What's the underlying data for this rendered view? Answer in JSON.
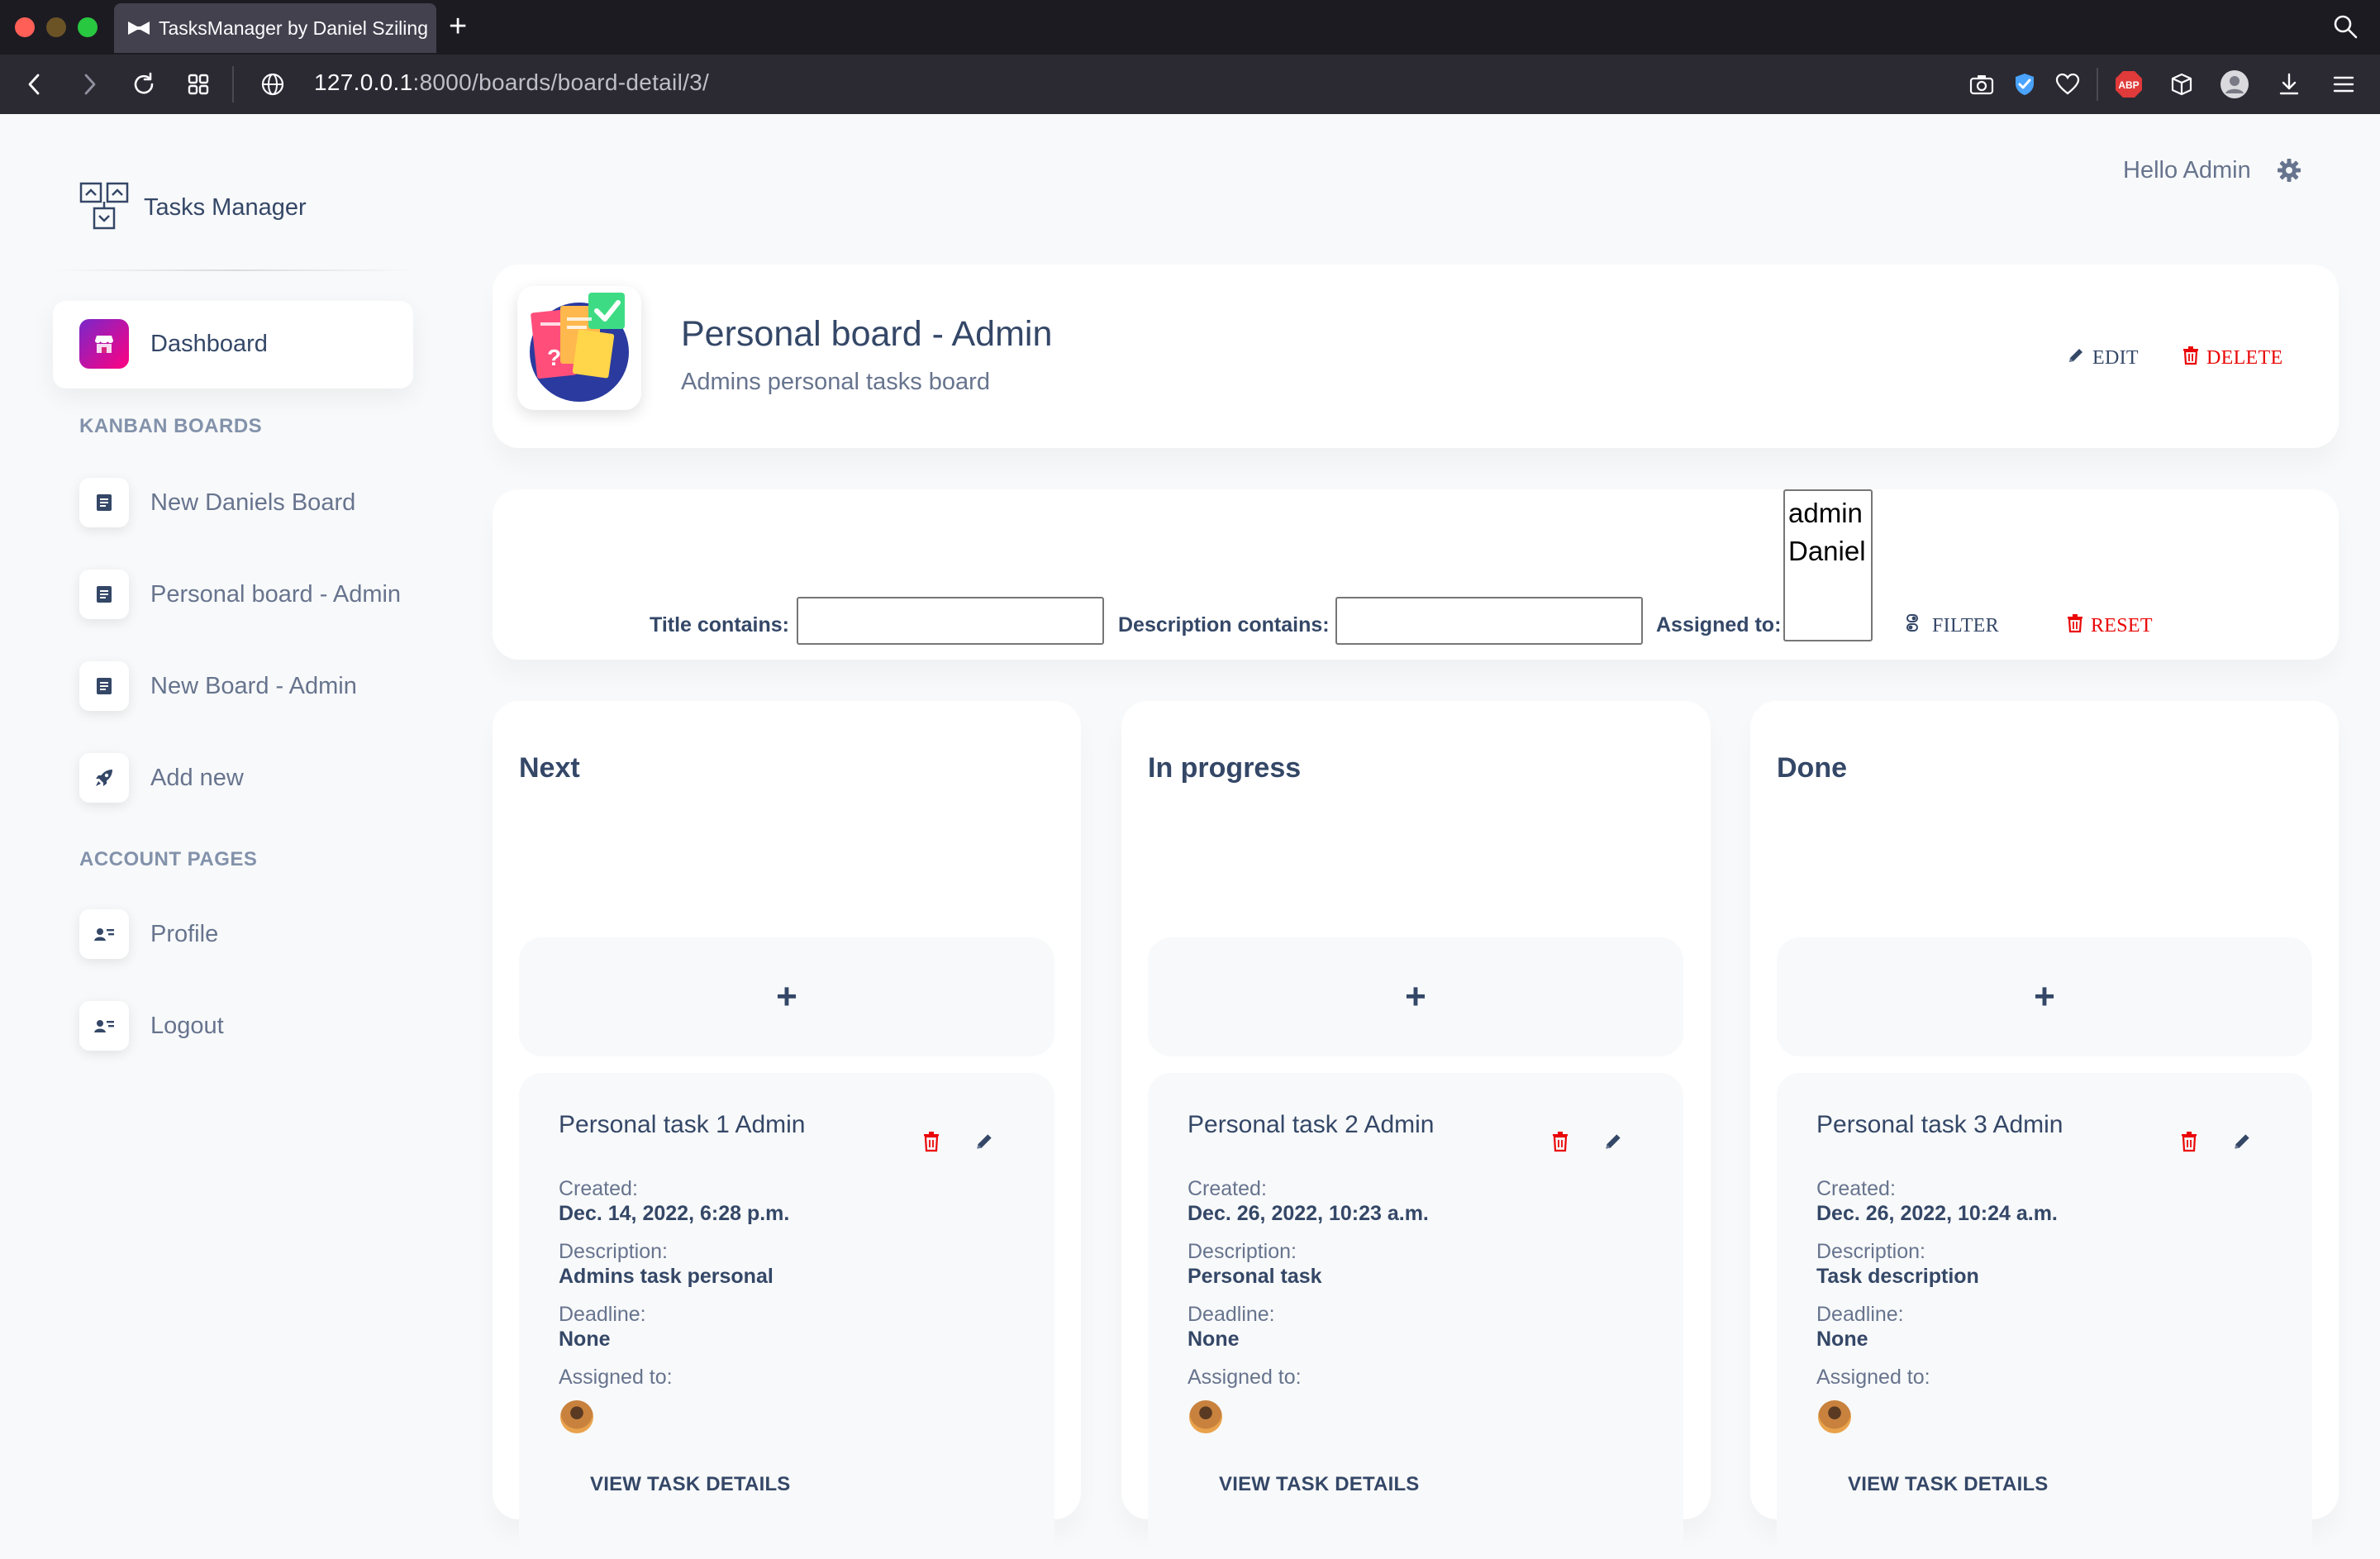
{
  "browser": {
    "tab_title": "TasksManager by Daniel Sziling",
    "new_tab_label": "+",
    "url_host": "127.0.0.1",
    "url_rest": ":8000/boards/board-detail/3/",
    "adblock_label": "ABP"
  },
  "brand": {
    "name": "Tasks Manager"
  },
  "header": {
    "greeting": "Hello Admin"
  },
  "sidebar": {
    "dashboard_label": "Dashboard",
    "kanban_heading": "KANBAN BOARDS",
    "boards": [
      "New Daniels Board",
      "Personal board - Admin",
      "New Board - Admin"
    ],
    "add_new_label": "Add new",
    "account_heading": "ACCOUNT PAGES",
    "profile_label": "Profile",
    "logout_label": "Logout"
  },
  "board": {
    "title": "Personal board - Admin",
    "description": "Admins personal tasks board",
    "edit_label": "EDIT",
    "delete_label": "DELETE"
  },
  "filter": {
    "title_label": "Title contains:",
    "title_value": "",
    "description_label": "Description contains:",
    "description_value": "",
    "assigned_label": "Assigned to:",
    "assigned_options": [
      "admin",
      "Daniel"
    ],
    "filter_label": "FILTER",
    "reset_label": "RESET"
  },
  "columns": [
    {
      "title": "Next",
      "add_label": "+",
      "task": {
        "title": "Personal task 1 Admin",
        "created_label": "Created:",
        "created": "Dec. 14, 2022, 6:28 p.m.",
        "description_label": "Description:",
        "description": "Admins task personal",
        "deadline_label": "Deadline:",
        "deadline": "None",
        "assigned_label": "Assigned to:",
        "view_label": "VIEW TASK DETAILS"
      }
    },
    {
      "title": "In progress",
      "add_label": "+",
      "task": {
        "title": "Personal task 2 Admin",
        "created_label": "Created:",
        "created": "Dec. 26, 2022, 10:23 a.m.",
        "description_label": "Description:",
        "description": "Personal task",
        "deadline_label": "Deadline:",
        "deadline": "None",
        "assigned_label": "Assigned to:",
        "view_label": "VIEW TASK DETAILS"
      }
    },
    {
      "title": "Done",
      "add_label": "+",
      "task": {
        "title": "Personal task 3 Admin",
        "created_label": "Created:",
        "created": "Dec. 26, 2022, 10:24 a.m.",
        "description_label": "Description:",
        "description": "Task description",
        "deadline_label": "Deadline:",
        "deadline": "None",
        "assigned_label": "Assigned to:",
        "view_label": "VIEW TASK DETAILS"
      }
    }
  ],
  "colors": {
    "accent_gradient_start": "#7928ca",
    "accent_gradient_end": "#ff0080",
    "danger": "#ea0606",
    "text_dark": "#344767",
    "text_muted": "#67748e"
  },
  "icons": {
    "tab_favicon": "bowtie-icon",
    "gear": "gear-icon",
    "board_item": "document-icon",
    "add_new": "rocket-icon",
    "profile": "user-card-icon",
    "edit": "pencil-icon",
    "delete": "trash-icon",
    "filter": "filter-icon"
  }
}
